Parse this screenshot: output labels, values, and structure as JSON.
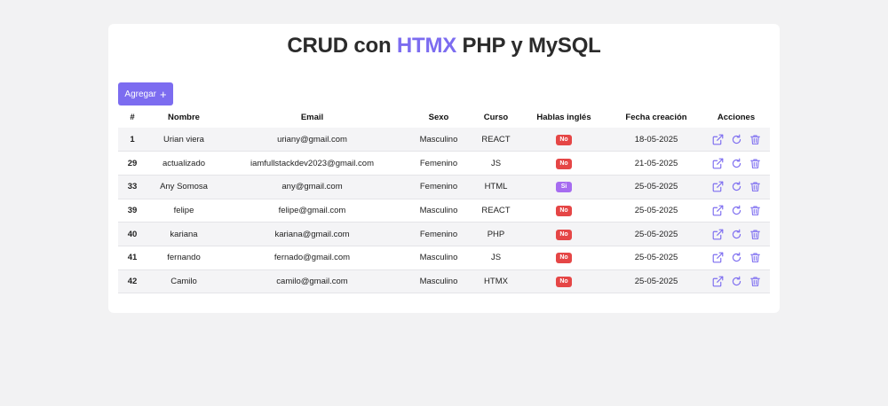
{
  "header": {
    "title_prefix": "CRUD con ",
    "title_accent": "HTMX",
    "title_suffix": " PHP y MySQL"
  },
  "toolbar": {
    "add_label": "Agregar",
    "add_icon": "plus-icon"
  },
  "table": {
    "columns": [
      "#",
      "Nombre",
      "Email",
      "Sexo",
      "Curso",
      "Hablas inglés",
      "Fecha creación",
      "Acciones"
    ],
    "rows": [
      {
        "id": "1",
        "nombre": "Urian viera",
        "email": "uriany@gmail.com",
        "sexo": "Masculino",
        "curso": "REACT",
        "ingles": "No",
        "fecha": "18-05-2025"
      },
      {
        "id": "29",
        "nombre": "actualizado",
        "email": "iamfullstackdev2023@gmail.com",
        "sexo": "Femenino",
        "curso": "JS",
        "ingles": "No",
        "fecha": "21-05-2025"
      },
      {
        "id": "33",
        "nombre": "Any Somosa",
        "email": "any@gmail.com",
        "sexo": "Femenino",
        "curso": "HTML",
        "ingles": "Si",
        "fecha": "25-05-2025"
      },
      {
        "id": "39",
        "nombre": "felipe",
        "email": "felipe@gmail.com",
        "sexo": "Masculino",
        "curso": "REACT",
        "ingles": "No",
        "fecha": "25-05-2025"
      },
      {
        "id": "40",
        "nombre": "kariana",
        "email": "kariana@gmail.com",
        "sexo": "Femenino",
        "curso": "PHP",
        "ingles": "No",
        "fecha": "25-05-2025"
      },
      {
        "id": "41",
        "nombre": "fernando",
        "email": "fernado@gmail.com",
        "sexo": "Masculino",
        "curso": "JS",
        "ingles": "No",
        "fecha": "25-05-2025"
      },
      {
        "id": "42",
        "nombre": "Camilo",
        "email": "camilo@gmail.com",
        "sexo": "Masculino",
        "curso": "HTMX",
        "ingles": "No",
        "fecha": "25-05-2025"
      }
    ],
    "action_icons": [
      "external-link-icon",
      "refresh-icon",
      "trash-icon"
    ]
  },
  "colors": {
    "accent": "#7c6cf0",
    "badge_no": "#e54646",
    "badge_si": "#a66cf0",
    "action_icon": "#7c6cf0"
  }
}
